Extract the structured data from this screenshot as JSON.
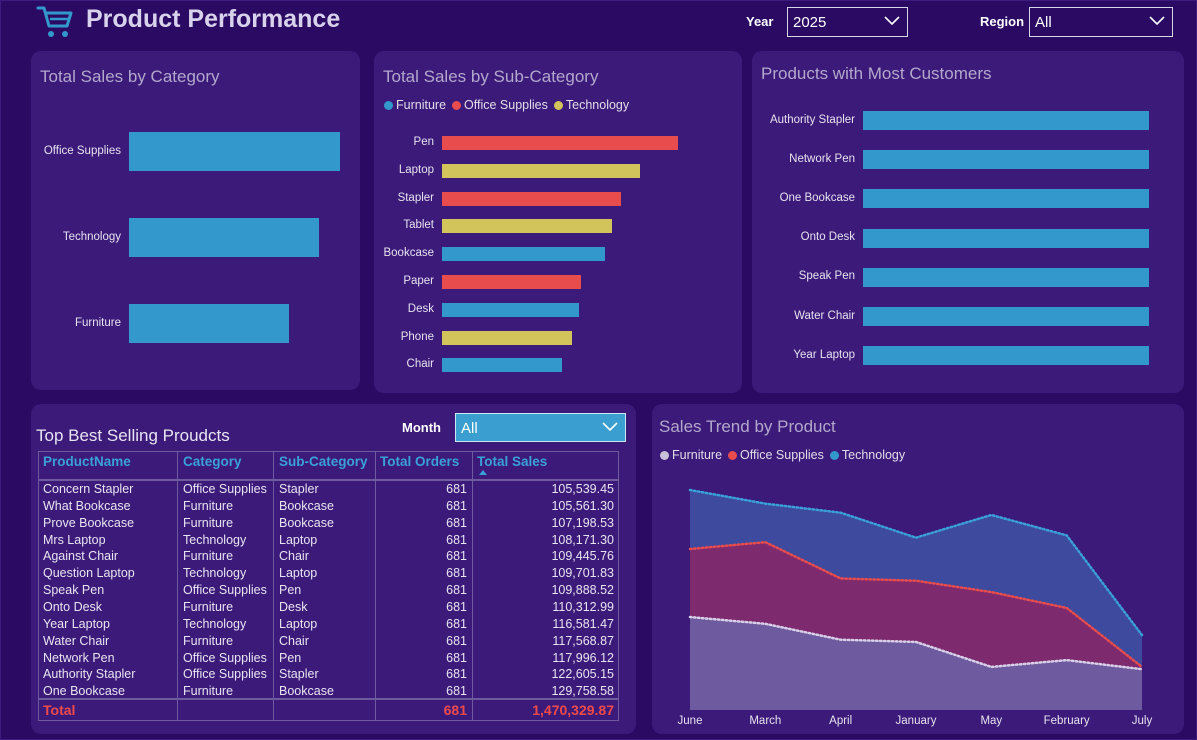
{
  "header": {
    "title": "Product Performance",
    "icon": "shopping-cart-icon",
    "year_label": "Year",
    "year_value": "2025",
    "region_label": "Region",
    "region_value": "All"
  },
  "colors": {
    "furniture": "#3399cc",
    "office_supplies": "#e84c4c",
    "technology": "#d2c35a",
    "background": "#2a0a63",
    "card": "#3c1a7a"
  },
  "category_card": {
    "title": "Total Sales by Category",
    "chart_data": {
      "type": "bar",
      "orientation": "horizontal",
      "categories": [
        "Office Supplies",
        "Technology",
        "Furniture"
      ],
      "values": [
        100,
        90,
        76
      ],
      "value_unit": "relative length (no axis shown)"
    }
  },
  "subcategory_card": {
    "title": "Total Sales by Sub-Category",
    "legend": [
      "Furniture",
      "Office Supplies",
      "Technology"
    ],
    "chart_data": {
      "type": "bar",
      "orientation": "horizontal",
      "categories": [
        "Pen",
        "Laptop",
        "Stapler",
        "Tablet",
        "Bookcase",
        "Paper",
        "Desk",
        "Phone",
        "Chair"
      ],
      "series_of_category": [
        "Office Supplies",
        "Technology",
        "Office Supplies",
        "Technology",
        "Furniture",
        "Office Supplies",
        "Furniture",
        "Technology",
        "Furniture"
      ],
      "values": [
        100,
        84,
        76,
        72,
        69,
        59,
        58,
        55,
        51
      ],
      "value_unit": "relative length (no axis shown)"
    }
  },
  "customers_card": {
    "title": "Products with Most Customers",
    "chart_data": {
      "type": "bar",
      "orientation": "horizontal",
      "categories": [
        "Authority Stapler",
        "Network Pen",
        "One Bookcase",
        "Onto Desk",
        "Speak Pen",
        "Water Chair",
        "Year Laptop"
      ],
      "values": [
        100,
        100,
        100,
        100,
        100,
        100,
        100
      ],
      "value_unit": "relative length (no axis shown)"
    }
  },
  "table_card": {
    "title": "Top Best Selling Proudcts",
    "month_label": "Month",
    "month_value": "All",
    "columns": [
      "ProductName",
      "Category",
      "Sub-Category",
      "Total Orders",
      "Total Sales"
    ],
    "rows": [
      [
        "Concern Stapler",
        "Office Supplies",
        "Stapler",
        "681",
        "105,539.45"
      ],
      [
        "What Bookcase",
        "Furniture",
        "Bookcase",
        "681",
        "105,561.30"
      ],
      [
        "Prove Bookcase",
        "Furniture",
        "Bookcase",
        "681",
        "107,198.53"
      ],
      [
        "Mrs Laptop",
        "Technology",
        "Laptop",
        "681",
        "108,171.30"
      ],
      [
        "Against Chair",
        "Furniture",
        "Chair",
        "681",
        "109,445.76"
      ],
      [
        "Question Laptop",
        "Technology",
        "Laptop",
        "681",
        "109,701.83"
      ],
      [
        "Speak Pen",
        "Office Supplies",
        "Pen",
        "681",
        "109,888.52"
      ],
      [
        "Onto Desk",
        "Furniture",
        "Desk",
        "681",
        "110,312.99"
      ],
      [
        "Year Laptop",
        "Technology",
        "Laptop",
        "681",
        "116,581.47"
      ],
      [
        "Water Chair",
        "Furniture",
        "Chair",
        "681",
        "117,568.87"
      ],
      [
        "Network Pen",
        "Office Supplies",
        "Pen",
        "681",
        "117,996.12"
      ],
      [
        "Authority Stapler",
        "Office Supplies",
        "Stapler",
        "681",
        "122,605.15"
      ],
      [
        "One Bookcase",
        "Furniture",
        "Bookcase",
        "681",
        "129,758.58"
      ]
    ],
    "total": {
      "label": "Total",
      "orders": "681",
      "sales": "1,470,329.87"
    }
  },
  "trend_card": {
    "title": "Sales Trend by Product",
    "legend": [
      "Furniture",
      "Office Supplies",
      "Technology"
    ],
    "chart_data": {
      "type": "area",
      "stacked": true,
      "x": [
        "June",
        "March",
        "April",
        "January",
        "May",
        "February",
        "July"
      ],
      "series": [
        {
          "name": "Furniture",
          "values": [
            41,
            38,
            31,
            30,
            19,
            22,
            18
          ]
        },
        {
          "name": "Office Supplies",
          "values": [
            30,
            36,
            27,
            27,
            33,
            23,
            1
          ]
        },
        {
          "name": "Technology",
          "values": [
            26,
            17,
            29,
            19,
            34,
            32,
            14
          ]
        }
      ],
      "value_unit": "relative (no y-axis shown)"
    }
  }
}
